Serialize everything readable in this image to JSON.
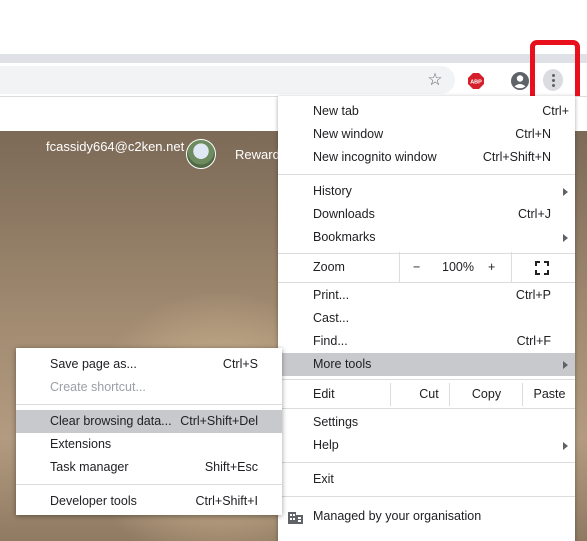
{
  "browser": {
    "icons": {
      "bookmark": "star-icon",
      "adblock": "abp-icon",
      "profile": "profile-icon",
      "menu": "kebab-menu-icon"
    },
    "adblock_label": "ABP",
    "highlight_color": "#e8101c"
  },
  "page": {
    "user_email": "fcassidy664@c2ken.net",
    "rewards_label": "Reward"
  },
  "menu": {
    "new_tab": {
      "label": "New tab",
      "shortcut": "Ctrl+"
    },
    "new_window": {
      "label": "New window",
      "shortcut": "Ctrl+N"
    },
    "new_incognito": {
      "label": "New incognito window",
      "shortcut": "Ctrl+Shift+N"
    },
    "history": {
      "label": "History"
    },
    "downloads": {
      "label": "Downloads",
      "shortcut": "Ctrl+J"
    },
    "bookmarks": {
      "label": "Bookmarks"
    },
    "zoom": {
      "label": "Zoom",
      "minus": "−",
      "value": "100%",
      "plus": "+"
    },
    "print": {
      "label": "Print...",
      "shortcut": "Ctrl+P"
    },
    "cast": {
      "label": "Cast..."
    },
    "find": {
      "label": "Find...",
      "shortcut": "Ctrl+F"
    },
    "more_tools": {
      "label": "More tools"
    },
    "edit": {
      "label": "Edit",
      "cut": "Cut",
      "copy": "Copy",
      "paste": "Paste"
    },
    "settings": {
      "label": "Settings"
    },
    "help": {
      "label": "Help"
    },
    "exit": {
      "label": "Exit"
    },
    "managed": {
      "label": "Managed by your organisation"
    }
  },
  "submenu": {
    "save_page": {
      "label": "Save page as...",
      "shortcut": "Ctrl+S"
    },
    "create_shortcut": {
      "label": "Create shortcut..."
    },
    "clear_data": {
      "label": "Clear browsing data...",
      "shortcut": "Ctrl+Shift+Del"
    },
    "extensions": {
      "label": "Extensions"
    },
    "task_manager": {
      "label": "Task manager",
      "shortcut": "Shift+Esc"
    },
    "dev_tools": {
      "label": "Developer tools",
      "shortcut": "Ctrl+Shift+I"
    }
  }
}
